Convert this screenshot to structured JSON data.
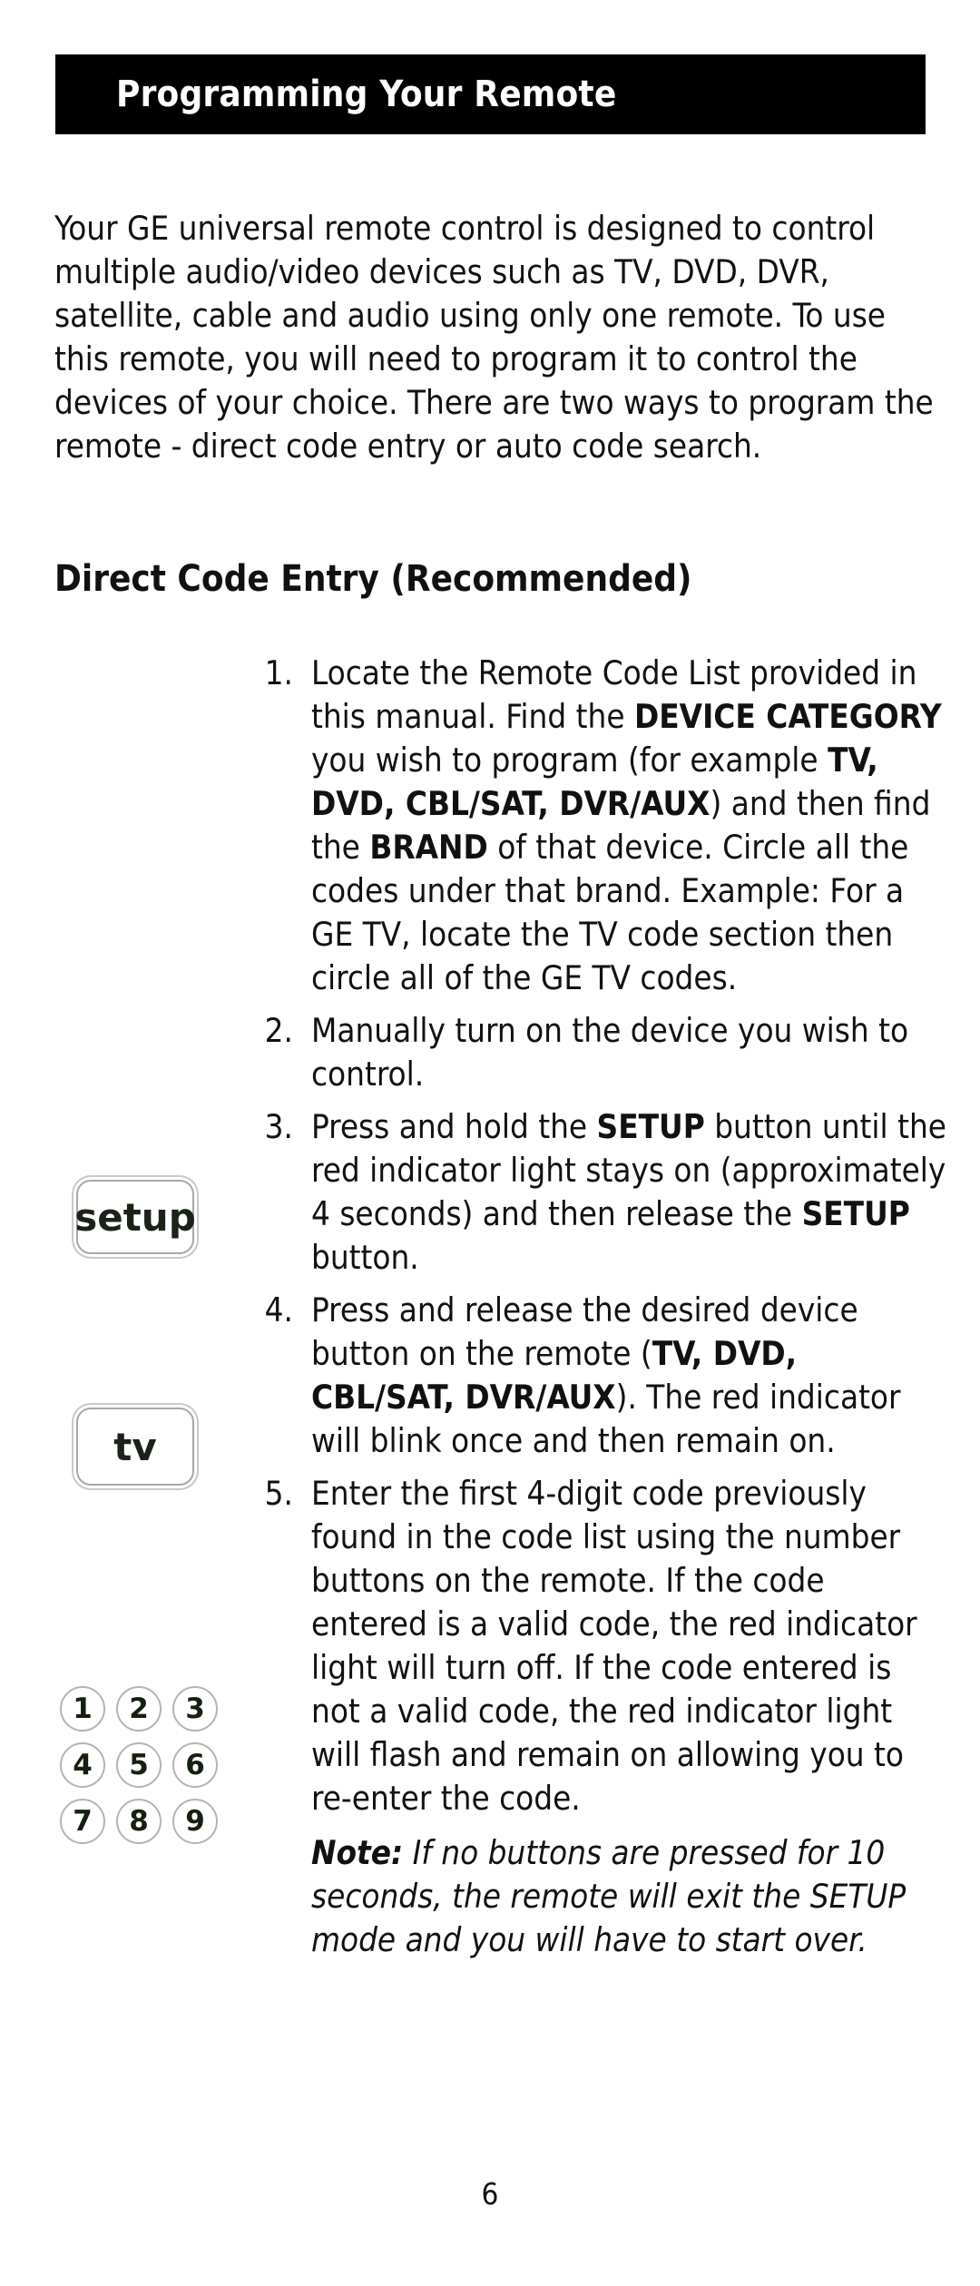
{
  "document": {
    "header_title": "Programming Your Remote",
    "page_number": "6",
    "intro_paragraph": "Your GE universal remote control is designed to control multiple audio/video devices such as TV, DVD, DVR, satellite, cable and audio using only one remote. To use this remote, you will need to program it to control the devices of your choice. There are two ways to program the remote - direct code entry or auto code search.",
    "section_heading": "Direct Code Entry (Recommended)"
  },
  "steps": [
    {
      "number": "1.",
      "segments": [
        {
          "text": "Locate the Remote Code List provided in this manual. Find the ",
          "bold": false
        },
        {
          "text": "DEVICE CATEGORY",
          "bold": true
        },
        {
          "text": " you wish to program (for example ",
          "bold": false
        },
        {
          "text": "TV, DVD, CBL/SAT, DVR/AUX",
          "bold": true
        },
        {
          "text": ") and then find the ",
          "bold": false
        },
        {
          "text": "BRAND",
          "bold": true
        },
        {
          "text": " of that device. Circle all the codes under that brand. Example: For a GE TV, locate the TV code section then circle all of the GE TV codes.",
          "bold": false
        }
      ]
    },
    {
      "number": "2.",
      "segments": [
        {
          "text": "Manually turn on the device you wish to control.",
          "bold": false
        }
      ]
    },
    {
      "number": "3.",
      "segments": [
        {
          "text": "Press and hold the ",
          "bold": false
        },
        {
          "text": "SETUP",
          "bold": true
        },
        {
          "text": " button until the red indicator light stays on (approximately 4 seconds) and then release the ",
          "bold": false
        },
        {
          "text": "SETUP",
          "bold": true
        },
        {
          "text": " button.",
          "bold": false
        }
      ]
    },
    {
      "number": "4.",
      "segments": [
        {
          "text": "Press and release the desired device button on the remote (",
          "bold": false
        },
        {
          "text": "TV, DVD, CBL/SAT, DVR/AUX",
          "bold": true
        },
        {
          "text": "). The red indicator will blink once and then remain on.",
          "bold": false
        }
      ]
    },
    {
      "number": "5.",
      "segments": [
        {
          "text": "Enter the first 4-digit code previously found in the code list using the number buttons on the remote. If the code entered is a valid code, the red indicator light will turn off. If the code entered is not a valid code, the red indicator light will flash and remain on allowing you to re-enter the code.",
          "bold": false
        }
      ]
    }
  ],
  "note": {
    "label": "Note:",
    "text": " If no buttons are pressed for 10 seconds, the remote will exit the SETUP mode and you will have to start over."
  },
  "remote_graphics": {
    "setup_button_label": "setup",
    "tv_button_label": "tv",
    "keypad_keys": [
      "1",
      "2",
      "3",
      "4",
      "5",
      "6",
      "7",
      "8",
      "9"
    ]
  },
  "colors": {
    "banner_background": "#000000",
    "banner_text": "#ffffff",
    "body_text": "#111111",
    "button_outline": "#a8a8a8"
  }
}
